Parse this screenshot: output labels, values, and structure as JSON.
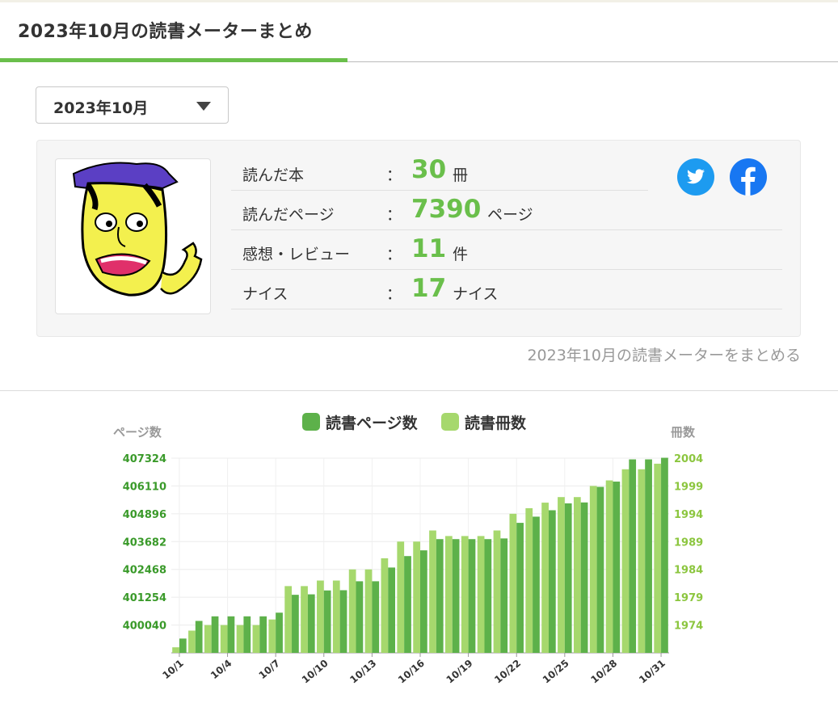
{
  "page_title": "2023年10月の読書メーターまとめ",
  "month_select": {
    "value": "2023年10月"
  },
  "stats": [
    {
      "label": "読んだ本",
      "value": "30",
      "unit": "冊"
    },
    {
      "label": "読んだページ",
      "value": "7390",
      "unit": "ページ"
    },
    {
      "label": "感想・レビュー",
      "value": "11",
      "unit": "件"
    },
    {
      "label": "ナイス",
      "value": "17",
      "unit": "ナイス"
    }
  ],
  "colon": "：",
  "share": {
    "twitter_icon": "twitter-icon",
    "facebook_icon": "facebook-icon"
  },
  "summarize_link": "2023年10月の読書メーターをまとめる",
  "colors": {
    "accent": "#6abf4b",
    "pages_bar": "#5db14a",
    "books_bar": "#a6d86d",
    "axis_left": "#3a9a2a",
    "axis_right": "#8cc63f"
  },
  "chart_data": {
    "type": "bar",
    "legend": [
      "読書ページ数",
      "読書冊数"
    ],
    "y_left_title": "ページ数",
    "y_right_title": "冊数",
    "y_left_ticks": [
      400040,
      401254,
      402468,
      403682,
      404896,
      406110,
      407324
    ],
    "y_right_ticks": [
      1974,
      1979,
      1984,
      1989,
      1994,
      1999,
      2004
    ],
    "x_tick_labels": [
      "10/1",
      "10/4",
      "10/7",
      "10/10",
      "10/13",
      "10/16",
      "10/19",
      "10/22",
      "10/25",
      "10/28",
      "10/31"
    ],
    "categories": [
      "10/1",
      "10/2",
      "10/3",
      "10/4",
      "10/5",
      "10/6",
      "10/7",
      "10/8",
      "10/9",
      "10/10",
      "10/11",
      "10/12",
      "10/13",
      "10/14",
      "10/15",
      "10/16",
      "10/17",
      "10/18",
      "10/19",
      "10/20",
      "10/21",
      "10/22",
      "10/23",
      "10/24",
      "10/25",
      "10/26",
      "10/27",
      "10/28",
      "10/29",
      "10/30",
      "10/31"
    ],
    "series": [
      {
        "name": "読書ページ数",
        "axis": "left",
        "values": [
          399450,
          400220,
          400420,
          400420,
          400420,
          400420,
          400580,
          401360,
          401380,
          401550,
          401560,
          401950,
          401950,
          402550,
          403050,
          403300,
          403790,
          403790,
          403790,
          403790,
          403820,
          404500,
          404770,
          405050,
          405350,
          405390,
          406070,
          406300,
          407270,
          407270,
          407340
        ]
      },
      {
        "name": "読書冊数",
        "axis": "right",
        "values": [
          1970,
          1973,
          1974,
          1974,
          1974,
          1974,
          1975,
          1981,
          1981,
          1982,
          1982,
          1984,
          1984,
          1986,
          1989,
          1989,
          1991,
          1990,
          1990,
          1990,
          1991,
          1994,
          1995,
          1996,
          1997,
          1997,
          1999,
          2000,
          2002,
          2002,
          2003
        ]
      }
    ]
  }
}
